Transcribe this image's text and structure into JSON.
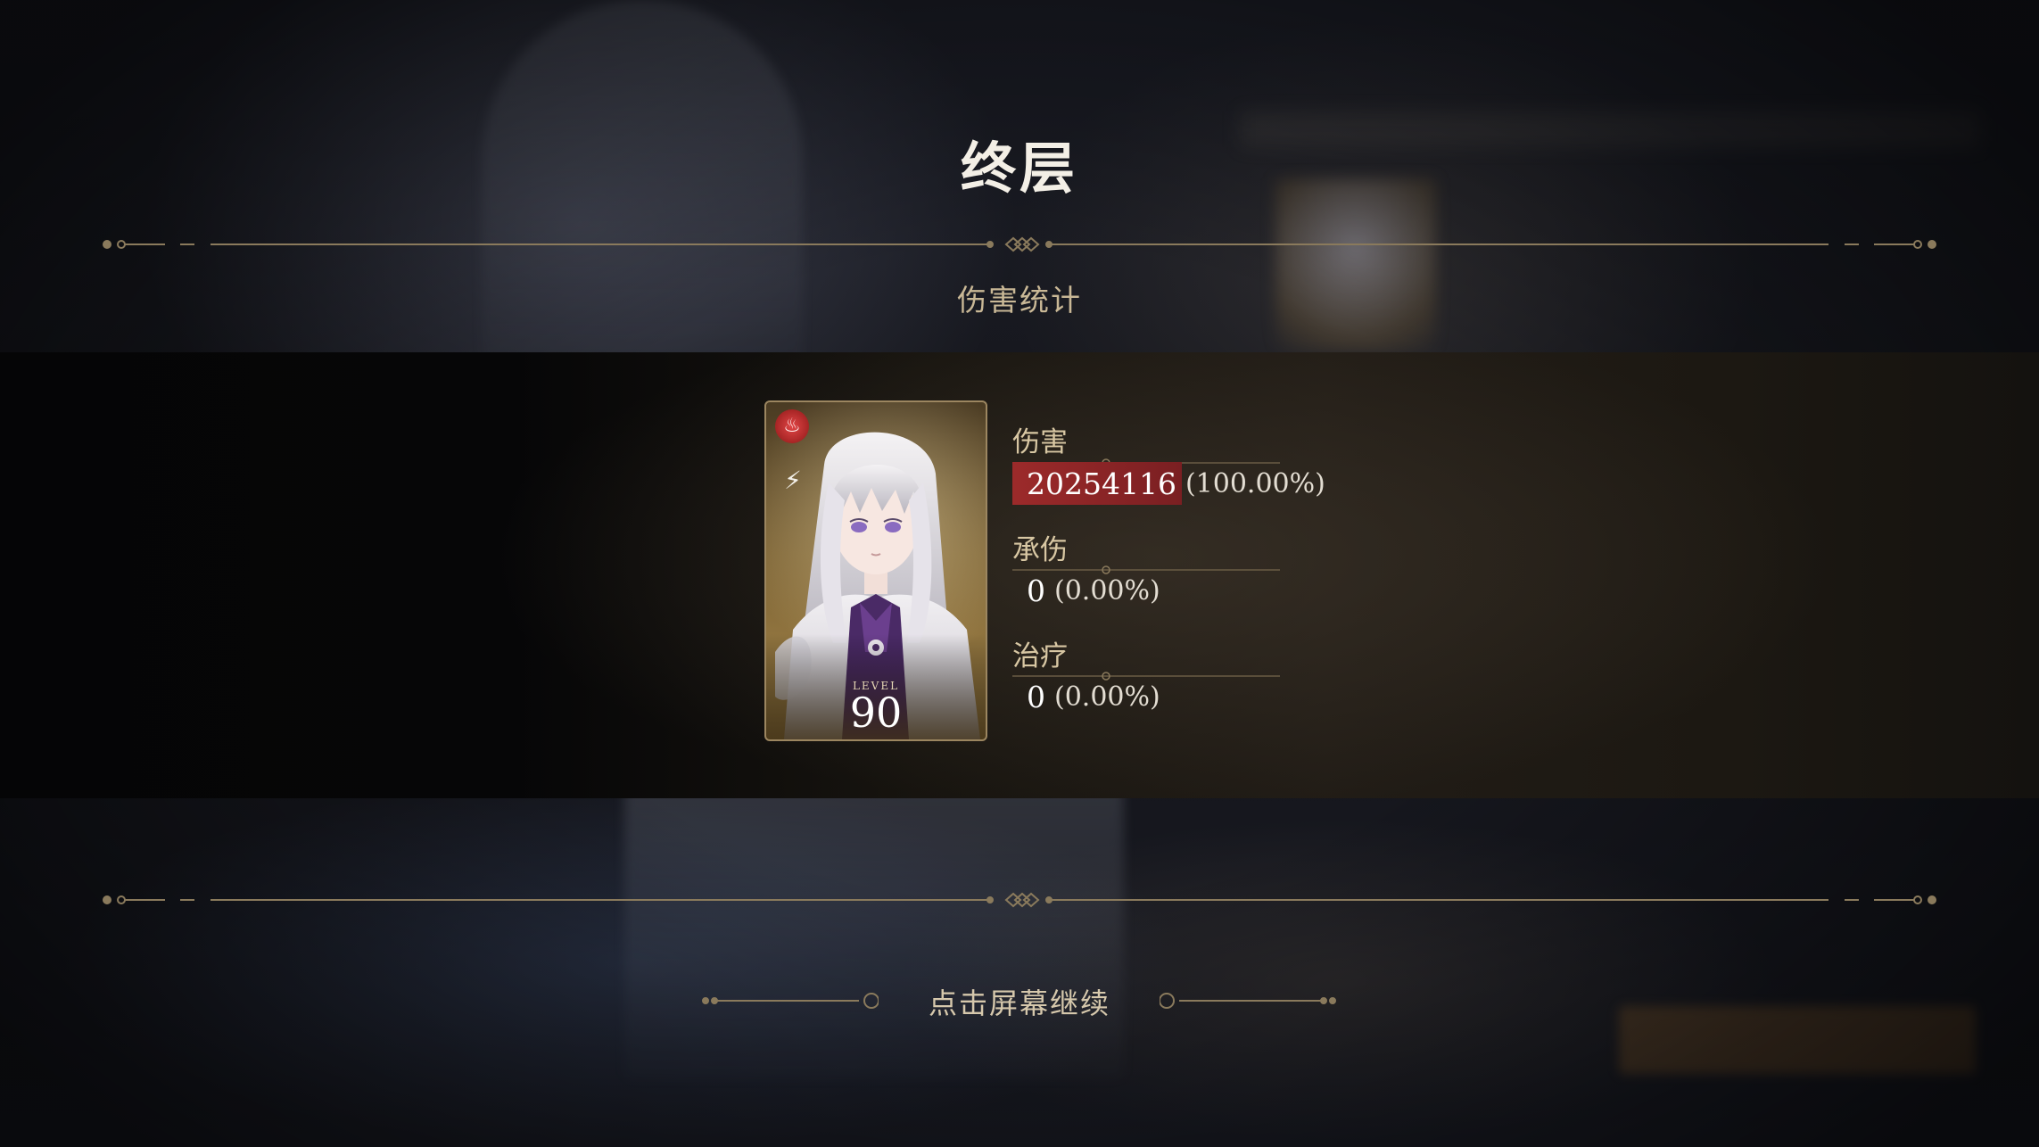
{
  "header": {
    "title": "终层",
    "subtitle": "伤害统计"
  },
  "character": {
    "level_label": "LEVEL",
    "level": "90",
    "element_icon": "fire-element-icon",
    "class_icon": "class-emblem-icon"
  },
  "stats": {
    "damage": {
      "label": "伤害",
      "value": "20254116",
      "percent": "(100.00%)",
      "share": 1.0
    },
    "taken": {
      "label": "承伤",
      "value": "0",
      "percent": "(0.00%)",
      "share": 0.0
    },
    "heal": {
      "label": "治疗",
      "value": "0",
      "percent": "(0.00%)",
      "share": 0.0
    }
  },
  "footer": {
    "continue_text": "点击屏幕继续"
  },
  "colors": {
    "accent_gold": "#c9b896",
    "damage_bar": "#9c2a2a",
    "divider": "#8a7a5c"
  }
}
